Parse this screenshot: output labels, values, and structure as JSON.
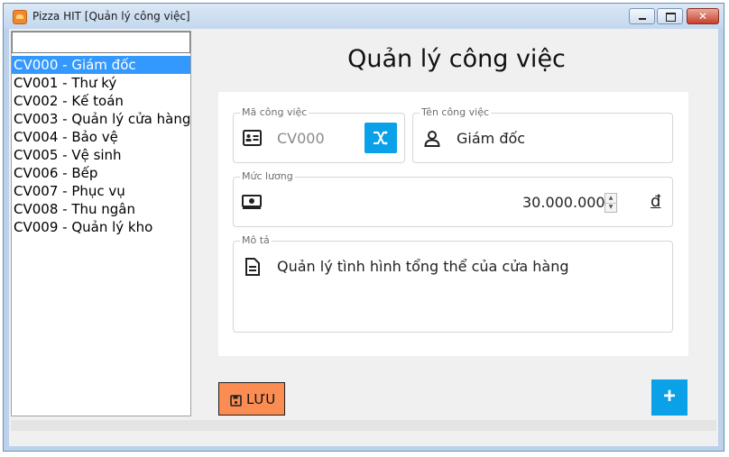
{
  "window": {
    "title": "Pizza HIT [Quản lý công việc]",
    "close_glyph": "✕"
  },
  "sidebar": {
    "search": {
      "value": "",
      "placeholder": ""
    },
    "items": [
      {
        "label": "CV000 - Giám đốc",
        "selected": true
      },
      {
        "label": "CV001 - Thư ký",
        "selected": false
      },
      {
        "label": "CV002 - Kế toán",
        "selected": false
      },
      {
        "label": "CV003 - Quản lý cửa hàng",
        "selected": false
      },
      {
        "label": "CV004 - Bảo vệ",
        "selected": false
      },
      {
        "label": "CV005 - Vệ sinh",
        "selected": false
      },
      {
        "label": "CV006 - Bếp",
        "selected": false
      },
      {
        "label": "CV007 - Phục vụ",
        "selected": false
      },
      {
        "label": "CV008 - Thu ngân",
        "selected": false
      },
      {
        "label": "CV009 - Quản lý kho",
        "selected": false
      }
    ]
  },
  "form": {
    "title": "Quản lý công việc",
    "ma_cong_viec": {
      "label": "Mã công việc",
      "value": "CV000",
      "icon": "id-card-icon",
      "action_icon": "shuffle-icon"
    },
    "ten_cong_viec": {
      "label": "Tên công việc",
      "value": "Giám đốc",
      "icon": "person-icon"
    },
    "muc_luong": {
      "label": "Mức lương",
      "value": "30.000.000",
      "currency": "đ",
      "icon": "money-icon"
    },
    "mo_ta": {
      "label": "Mô tả",
      "value": "Quản lý tình hình tổng thể của cửa hàng",
      "icon": "document-icon"
    }
  },
  "actions": {
    "save_label": "LƯU",
    "add_glyph": "+"
  },
  "colors": {
    "accent_blue": "#0aa1e8",
    "save_orange": "#fb8c52",
    "selection": "#3399ff"
  }
}
